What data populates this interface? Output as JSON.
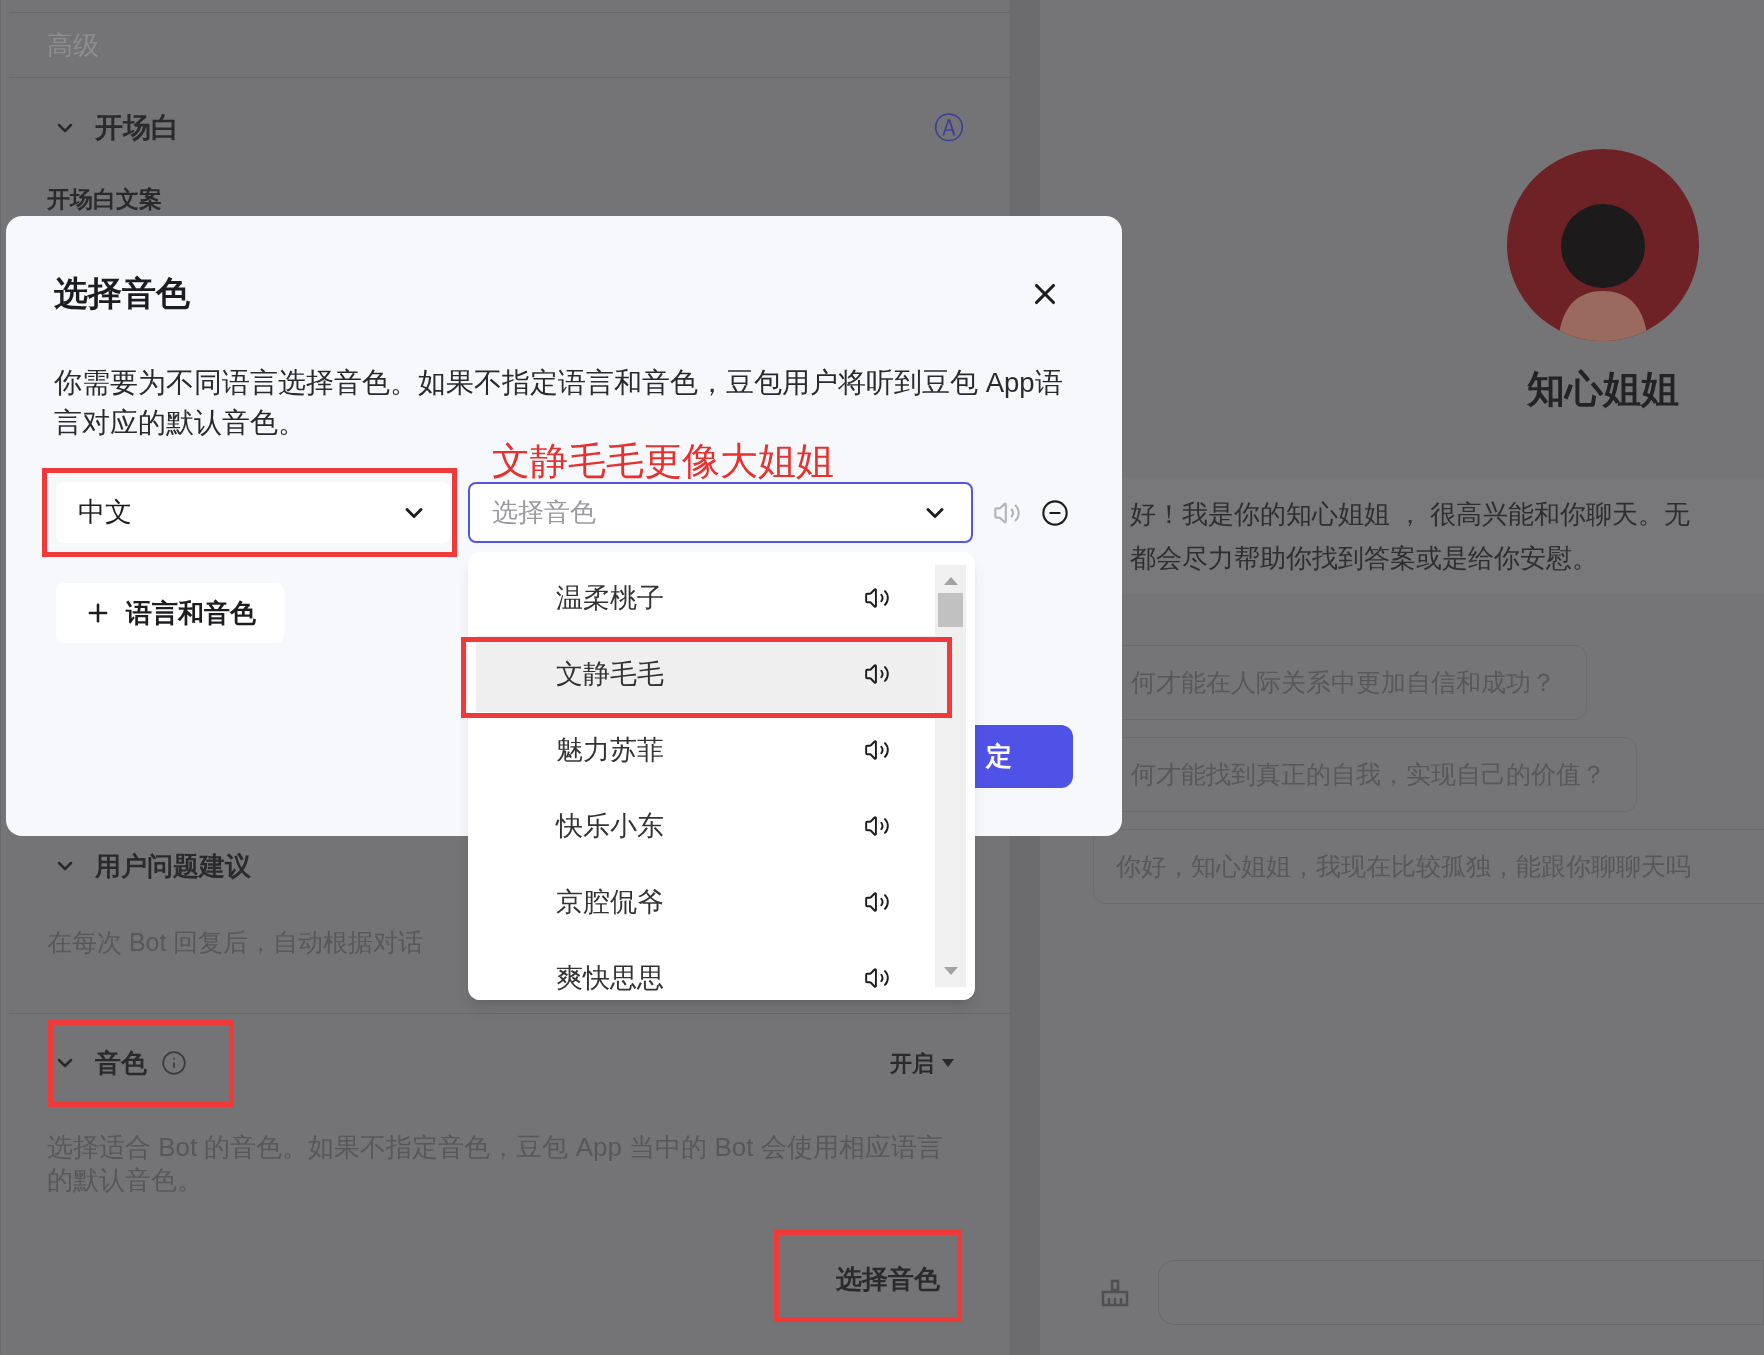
{
  "left_panel": {
    "section_label": "高级",
    "opening": {
      "title": "开场白",
      "expanded": true,
      "mode_icon": "Ⓐ",
      "label": "开场白文案"
    },
    "suggestions": {
      "title": "用户问题建议",
      "expanded": true,
      "description": "在每次 Bot 回复后，自动根据对话"
    },
    "voice": {
      "title": "音色",
      "expanded": true,
      "status": "开启",
      "description": "选择适合 Bot 的音色。如果不指定音色，豆包 App 当中的 Bot 会使用相应语言的默认音色。",
      "button": "选择音色"
    }
  },
  "chat": {
    "bot_name": "知心姐姐",
    "greeting_lines": [
      "好！我是你的知心姐姐 ， 很高兴能和你聊天。无",
      "都会尽力帮助你找到答案或是给你安慰。"
    ],
    "suggestions": [
      "何才能在人际关系中更加自信和成功？",
      "何才能找到真正的自我，实现自己的价值？",
      "你好，知心姐姐，我现在比较孤独，能跟你聊聊天吗"
    ]
  },
  "dialog": {
    "title": "选择音色",
    "description": "你需要为不同语言选择音色。如果不指定语言和音色，豆包用户将听到豆包 App语言对应的默认音色。",
    "language": "中文",
    "voice_placeholder": "选择音色",
    "add_button": "语言和音色",
    "confirm_button": "定",
    "voice_options": [
      {
        "name": "温柔桃子",
        "selected": false
      },
      {
        "name": "文静毛毛",
        "selected": true
      },
      {
        "name": "魅力苏菲",
        "selected": false
      },
      {
        "name": "快乐小东",
        "selected": false
      },
      {
        "name": "京腔侃爷",
        "selected": false
      },
      {
        "name": "爽快思思",
        "selected": false
      }
    ]
  },
  "annotation": {
    "text": "文静毛毛更像大姐姐"
  }
}
